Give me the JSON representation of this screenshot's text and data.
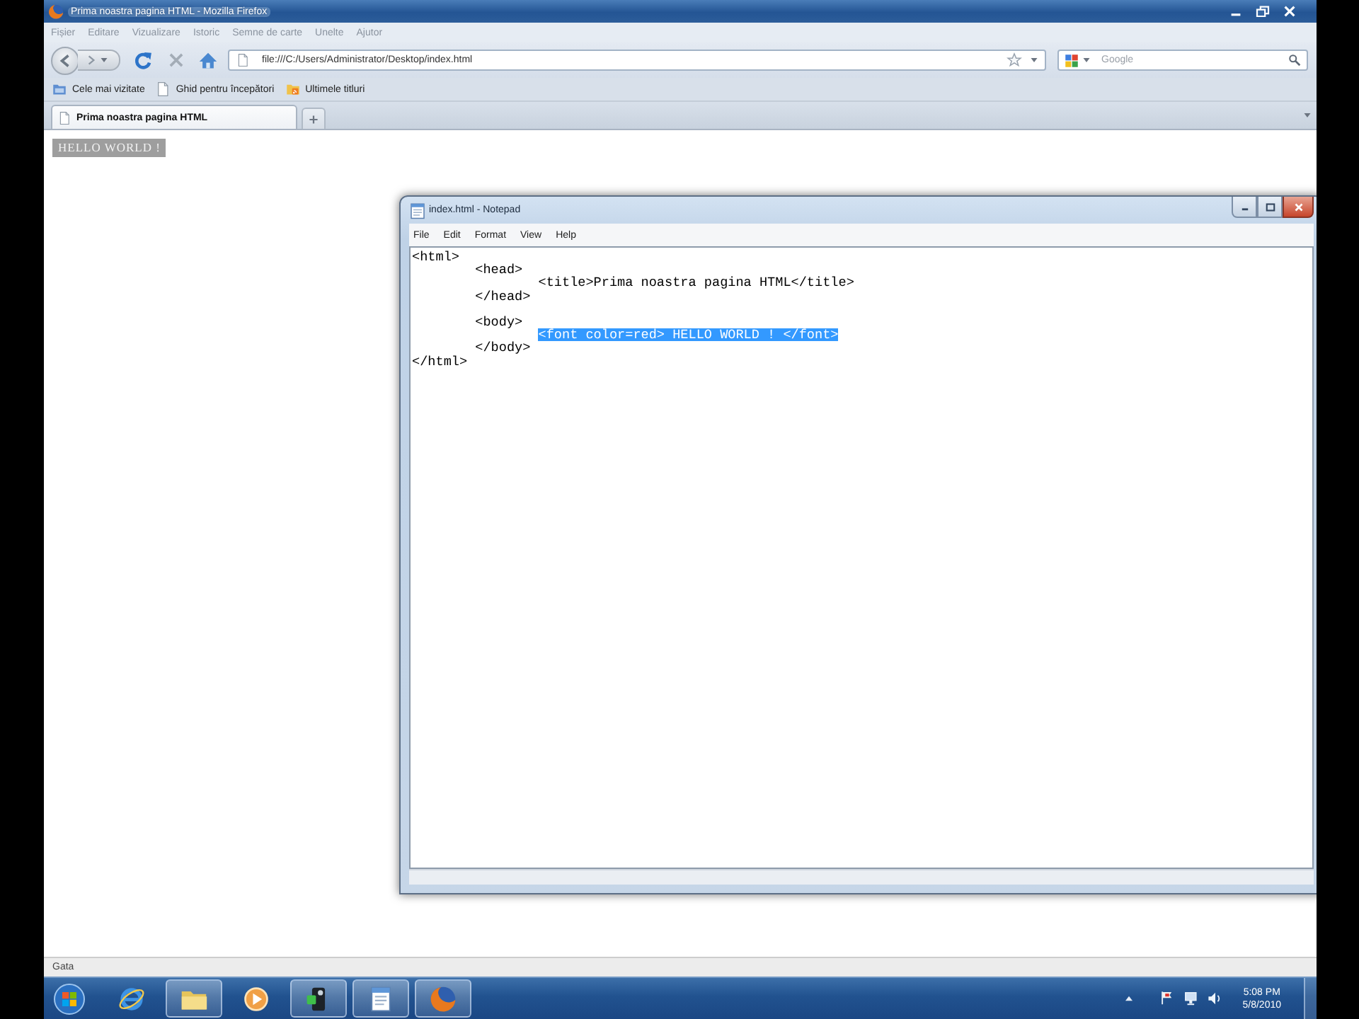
{
  "browser": {
    "title": "Prima noastra pagina HTML - Mozilla Firefox",
    "menu": [
      "Fișier",
      "Editare",
      "Vizualizare",
      "Istoric",
      "Semne de carte",
      "Unelte",
      "Ajutor"
    ],
    "address": "file:///C:/Users/Administrator/Desktop/index.html",
    "search": {
      "placeholder": "Google"
    },
    "bookmarks": [
      {
        "label": "Cele mai vizitate",
        "kind": "smart"
      },
      {
        "label": "Ghid pentru începători",
        "kind": "page"
      },
      {
        "label": "Ultimele titluri",
        "kind": "feed"
      }
    ],
    "tabs": [
      {
        "label": "Prima noastra pagina HTML",
        "selected": true
      }
    ],
    "page": {
      "text": "HELLO WORLD !"
    },
    "status_bar": "Gata"
  },
  "notepad": {
    "title": "index.html - Notepad",
    "menu": [
      "File",
      "Edit",
      "Format",
      "View",
      "Help"
    ],
    "lines": [
      {
        "kind": "code",
        "text": "<html>",
        "selected": false,
        "children": [
          {
            "kind": "code",
            "text": "<head>",
            "selected": false,
            "children": [
              {
                "kind": "code",
                "text": "<title>Prima noastra pagina HTML</title>",
                "selected": false
              }
            ]
          },
          {
            "kind": "code",
            "text": "</head>",
            "selected": false
          },
          {
            "kind": "blank",
            "selected": false
          },
          {
            "kind": "code",
            "text": "<body>",
            "selected": false,
            "children": [
              {
                "kind": "code",
                "text": "<font color=red> HELLO WORLD ! </font>",
                "selected": true
              }
            ]
          },
          {
            "kind": "code",
            "text": "</body>",
            "selected": false
          }
        ]
      },
      {
        "kind": "code",
        "text": "</html>",
        "selected": false
      }
    ]
  },
  "taskbar": {
    "items": [
      {
        "kind": "browser",
        "running": false
      },
      {
        "kind": "folder",
        "running": true
      },
      {
        "kind": "media",
        "running": false
      },
      {
        "kind": "app",
        "running": true
      },
      {
        "kind": "notepad",
        "running": true
      },
      {
        "kind": "firefox",
        "running": true
      }
    ],
    "clock": {
      "time": "5:08 PM",
      "date": "5/8/2010"
    }
  }
}
